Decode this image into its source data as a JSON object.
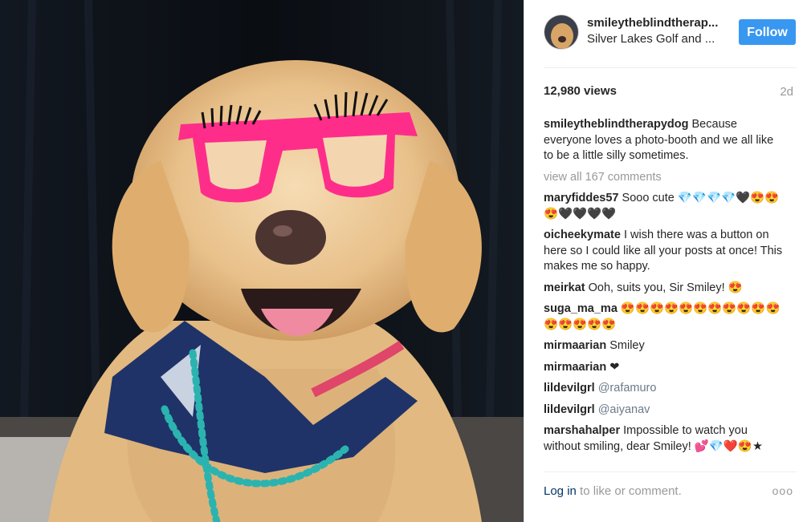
{
  "post": {
    "username": "smileytheblindtherap...",
    "location": "Silver Lakes Golf and ...",
    "follow_label": "Follow",
    "views": "12,980 views",
    "time_ago": "2d"
  },
  "caption": {
    "user": "smileytheblindtherapydog",
    "text": "Because everyone loves a photo-booth and we all like to be a little silly sometimes."
  },
  "view_all_label": "view all 167 comments",
  "comments": [
    {
      "user": "maryfiddes57",
      "text": "Sooo cute 💎💎💎💎🖤😍😍😍🖤🖤🖤🖤"
    },
    {
      "user": "oicheekymate",
      "text": "I wish there was a button on here so I could like all your posts at once! This makes me so happy."
    },
    {
      "user": "meirkat",
      "text": "Ooh, suits you, Sir Smiley! 😍"
    },
    {
      "user": "suga_ma_ma",
      "text": "😍😍😍😍😍😍😍😍😍😍😍😍😍😍😍😍"
    },
    {
      "user": "mirmaarian",
      "text": "Smiley"
    },
    {
      "user": "mirmaarian",
      "text": "❤"
    },
    {
      "user": "lildevilgrl",
      "text": "@rafamuro",
      "mention": true
    },
    {
      "user": "lildevilgrl",
      "text": "@aiyanav",
      "mention": true
    },
    {
      "user": "marshahalper",
      "text": "Impossible to watch you without smiling, dear Smiley! 💕💎❤️😍★"
    }
  ],
  "footer": {
    "login_link": "Log in",
    "login_rest": " to like or comment.",
    "more_label": "ooo"
  },
  "colors": {
    "accent": "#3897f0",
    "glasses": "#ff2d8a",
    "bandana": "#1f3368"
  }
}
